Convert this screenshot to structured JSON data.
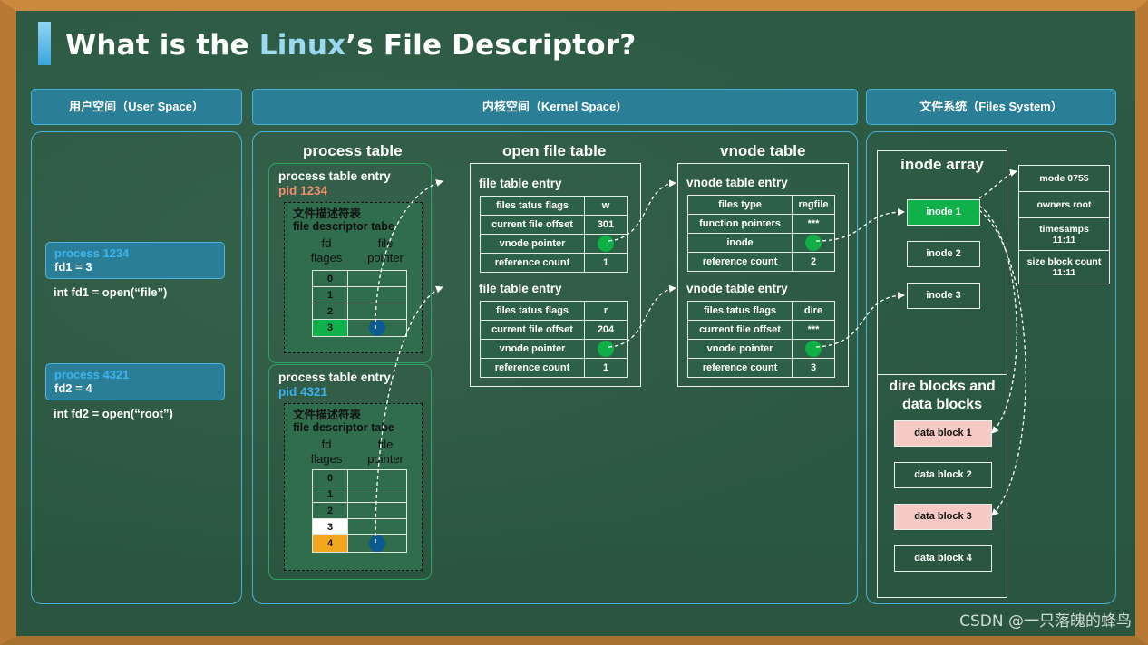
{
  "title": {
    "part1": "What is the ",
    "highlight": "Linux",
    "part2": "’s File Descriptor?"
  },
  "sections": {
    "user": "用户空间（User Space）",
    "kernel": "内核空间（Kernel Space）",
    "fs": "文件系统（Files System）"
  },
  "user_space": {
    "proc_a": {
      "name": "process 1234",
      "fd": "fd1 = 3",
      "code": "int fd1 = open(“file”)"
    },
    "proc_b": {
      "name": "process 4321",
      "fd": "fd2 = 4",
      "code": "int fd2 = open(“root”)"
    }
  },
  "process_table": {
    "title": "process table",
    "entries": [
      {
        "label": "process table entry",
        "pid": "pid 1234",
        "fdtable_cn": "文件描述符表",
        "fdtable_en": "file descriptor tabe",
        "col1": "fd\nflages",
        "col2": "file\npointer",
        "rows": [
          "0",
          "1",
          "2",
          "3"
        ]
      },
      {
        "label": "process table entry",
        "pid": "pid 4321",
        "fdtable_cn": "文件描述符表",
        "fdtable_en": "file descriptor tabe",
        "col1": "fd\nflages",
        "col2": "file\npointer",
        "rows": [
          "0",
          "1",
          "2",
          "3",
          "4"
        ]
      }
    ]
  },
  "open_file_table": {
    "title": "open file table",
    "entries": [
      {
        "label": "file table entry",
        "rows": [
          [
            "files tatus flags",
            "w"
          ],
          [
            "current file offset",
            "301"
          ],
          [
            "vnode pointer",
            ""
          ],
          [
            "reference count",
            "1"
          ]
        ]
      },
      {
        "label": "file table entry",
        "rows": [
          [
            "files tatus flags",
            "r"
          ],
          [
            "current file offset",
            "204"
          ],
          [
            "vnode pointer",
            ""
          ],
          [
            "reference count",
            "1"
          ]
        ]
      }
    ]
  },
  "vnode_table": {
    "title": "vnode table",
    "entries": [
      {
        "label": "vnode table entry",
        "rows": [
          [
            "files type",
            "regfile"
          ],
          [
            "function pointers",
            "***"
          ],
          [
            "inode",
            ""
          ],
          [
            "reference count",
            "2"
          ]
        ]
      },
      {
        "label": "vnode table entry",
        "rows": [
          [
            "files tatus flags",
            "dire"
          ],
          [
            "current file offset",
            "***"
          ],
          [
            "vnode pointer",
            ""
          ],
          [
            "reference count",
            "3"
          ]
        ]
      }
    ]
  },
  "file_system": {
    "inode_title": "inode array",
    "inodes": [
      "inode 1",
      "inode 2",
      "inode 3"
    ],
    "attrs": [
      "mode 0755",
      "owners root",
      "timesamps\n11:11",
      "size block count\n11:11"
    ],
    "blocks_title": "dire blocks and\ndata blocks",
    "blocks": [
      "data block 1",
      "data block 2",
      "data block 3",
      "data block 4"
    ]
  },
  "watermark": "CSDN @一只落魄的蜂鸟"
}
